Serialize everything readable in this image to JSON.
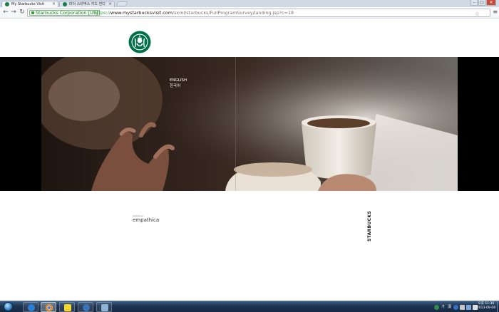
{
  "browser": {
    "tabs": [
      {
        "title": "My Starbucks Visit",
        "active": true
      },
      {
        "title": "마이 스타벅스 키드 컨디",
        "active": false
      }
    ],
    "window_buttons": {
      "minimize": "–",
      "maximize": "□",
      "close": "✕"
    },
    "nav": {
      "back": "←",
      "forward": "→",
      "reload": "↻"
    },
    "ev_cert": "Starbucks Corporation [US]",
    "url": {
      "scheme": "https://",
      "host": "www.mystarbucksvisit.com",
      "path": "/sxml/starbucks/FullProgramSurvey/landing.jsp?c=18"
    },
    "star_glyph": "☆",
    "menu_glyph": "≡"
  },
  "page": {
    "languages": {
      "english": "ENGLISH",
      "korean": "한국어"
    },
    "side_brand": "STARBUCKS",
    "footer": {
      "powered_by": "powered by",
      "brand": "empathica"
    },
    "colors": {
      "starbucks_green": "#00704a",
      "hero_bg": "#000000"
    }
  },
  "taskbar": {
    "items": [
      {
        "name": "internet-explorer-icon",
        "color": "#2a7fd4"
      },
      {
        "name": "chrome-icon",
        "color": "#d64a35",
        "active": true
      },
      {
        "name": "kakaotalk-icon",
        "color": "#f5d62b"
      },
      {
        "name": "media-player-icon",
        "color": "#3b72b8"
      },
      {
        "name": "explorer-icon",
        "color": "#8fb3d6"
      }
    ],
    "tray": {
      "lang": "가",
      "ime": "漢"
    },
    "clock": {
      "period": "오후",
      "time": "11:36",
      "date": "2013-09-08"
    }
  }
}
